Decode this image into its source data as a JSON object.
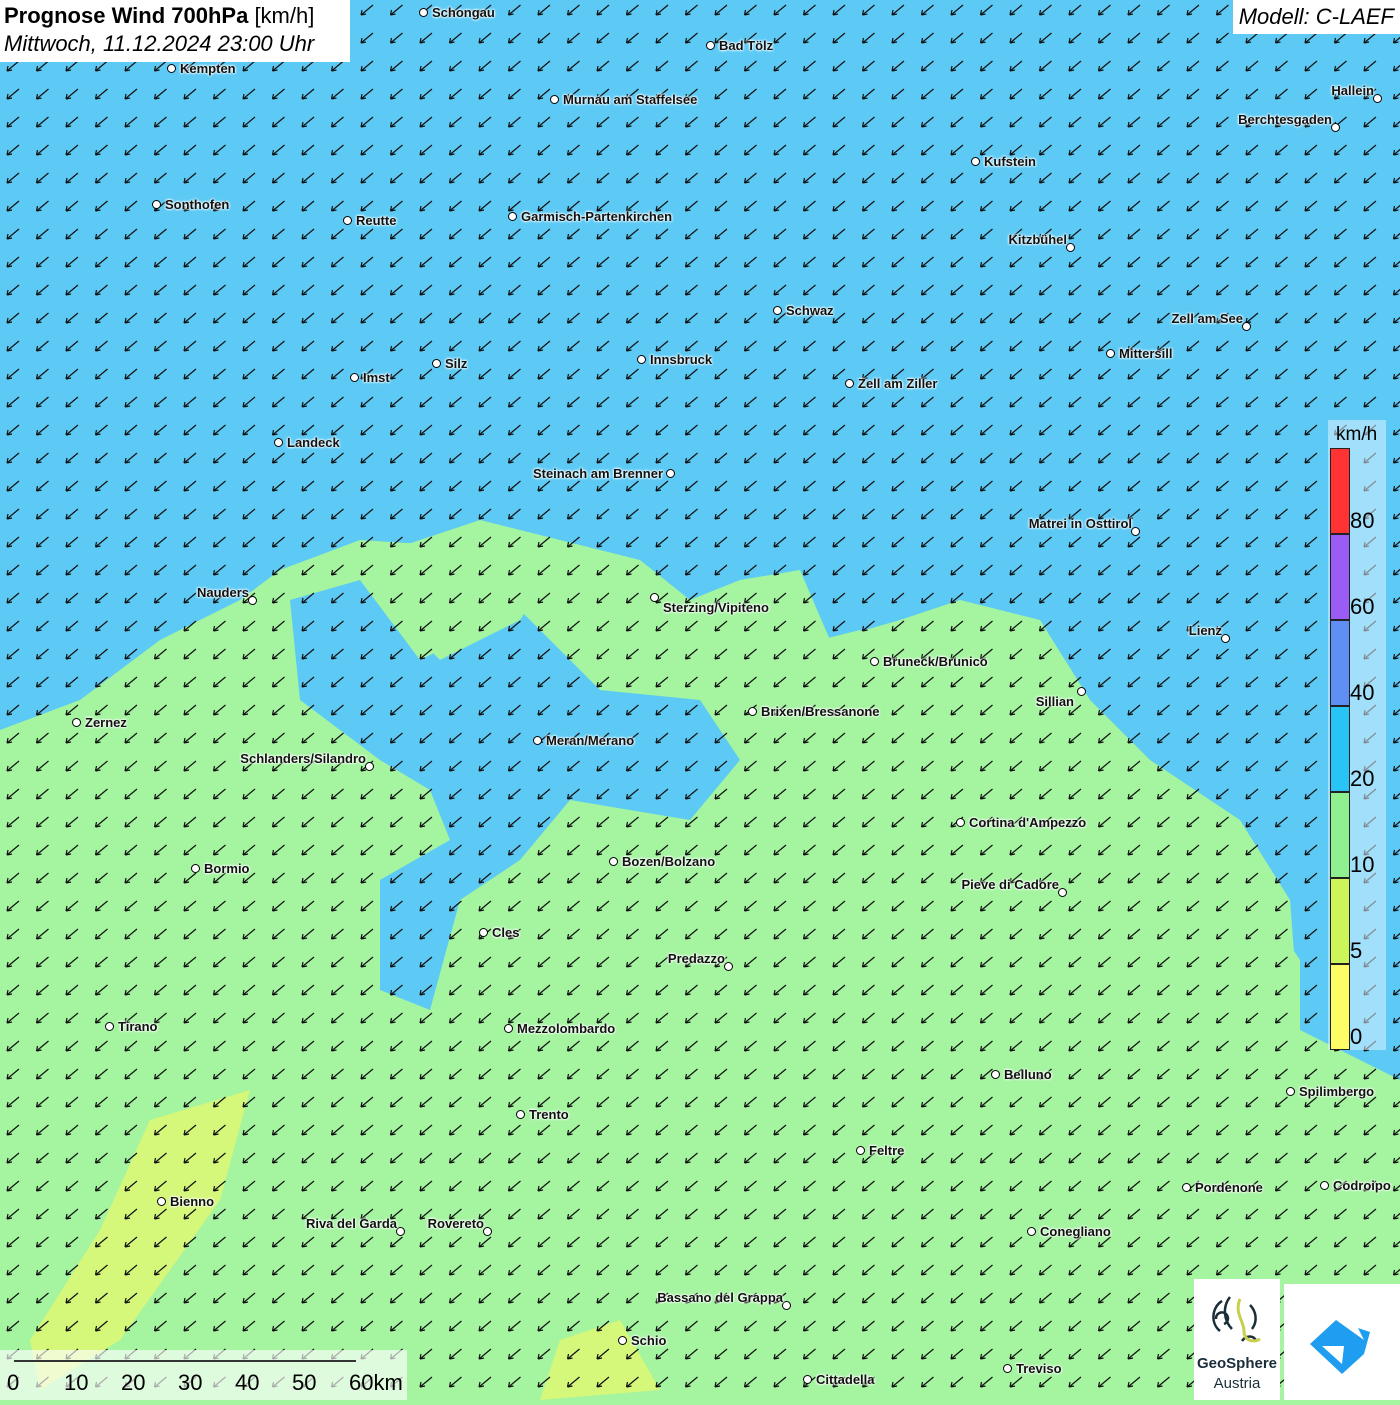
{
  "header": {
    "title": "Prognose Wind 700hPa",
    "unit": "[km/h]",
    "datetime": "Mittwoch, 11.12.2024 23:00 Uhr",
    "model": "Modell: C-LAEF"
  },
  "legend": {
    "unit": "km/h",
    "labels": [
      "80",
      "60",
      "40",
      "20",
      "10",
      "5",
      "0"
    ],
    "colors": [
      "#ff3333",
      "#9a5cf5",
      "#5f8ff5",
      "#27c4f5",
      "#8ff08f",
      "#ccf55a",
      "#fdfd66"
    ]
  },
  "scale": {
    "ticks": [
      "0",
      "10",
      "20",
      "30",
      "40",
      "50",
      "60km"
    ]
  },
  "logos": {
    "geosphere_line1": "GeoSphere",
    "geosphere_line2": "Austria"
  },
  "colors": {
    "blue_area": "#5ccaf5",
    "green_area": "#a4f4a0",
    "yellow_area": "#d5f77a"
  },
  "wind": {
    "direction": "northeast",
    "icon": "arrow-southwest"
  },
  "cities": [
    "Schongau",
    "Bad Tölz",
    "Kempten",
    "Murnau am Staffelsee",
    "Hallein",
    "Berchtesgaden",
    "Kufstein",
    "Sonthofen",
    "Reutte",
    "Garmisch-Partenkirchen",
    "Kitzbühel",
    "Schwaz",
    "Zell am See",
    "Mittersill",
    "Innsbruck",
    "Silz",
    "Imst",
    "Zell am Ziller",
    "Landeck",
    "Steinach am Brenner",
    "Matrei in Osttirol",
    "Nauders",
    "Sterzing/Vipiteno",
    "Lienz",
    "Bruneck/Brunico",
    "Sillian",
    "Brixen/Bressanone",
    "Zernez",
    "Meran/Merano",
    "Schlanders/Silandro",
    "Cortina d'Ampezzo",
    "Bozen/Bolzano",
    "Bormio",
    "Pieve di Cadore",
    "Cles",
    "Predazzo",
    "Tirano",
    "Mezzolombardo",
    "Belluno",
    "Spilimbergo",
    "Trento",
    "Feltre",
    "Pordenone",
    "Codroipo",
    "Bienno",
    "Riva del Garda",
    "Rovereto",
    "Conegliano",
    "Bassano del Grappa",
    "Schio",
    "Treviso",
    "Cittadella"
  ]
}
